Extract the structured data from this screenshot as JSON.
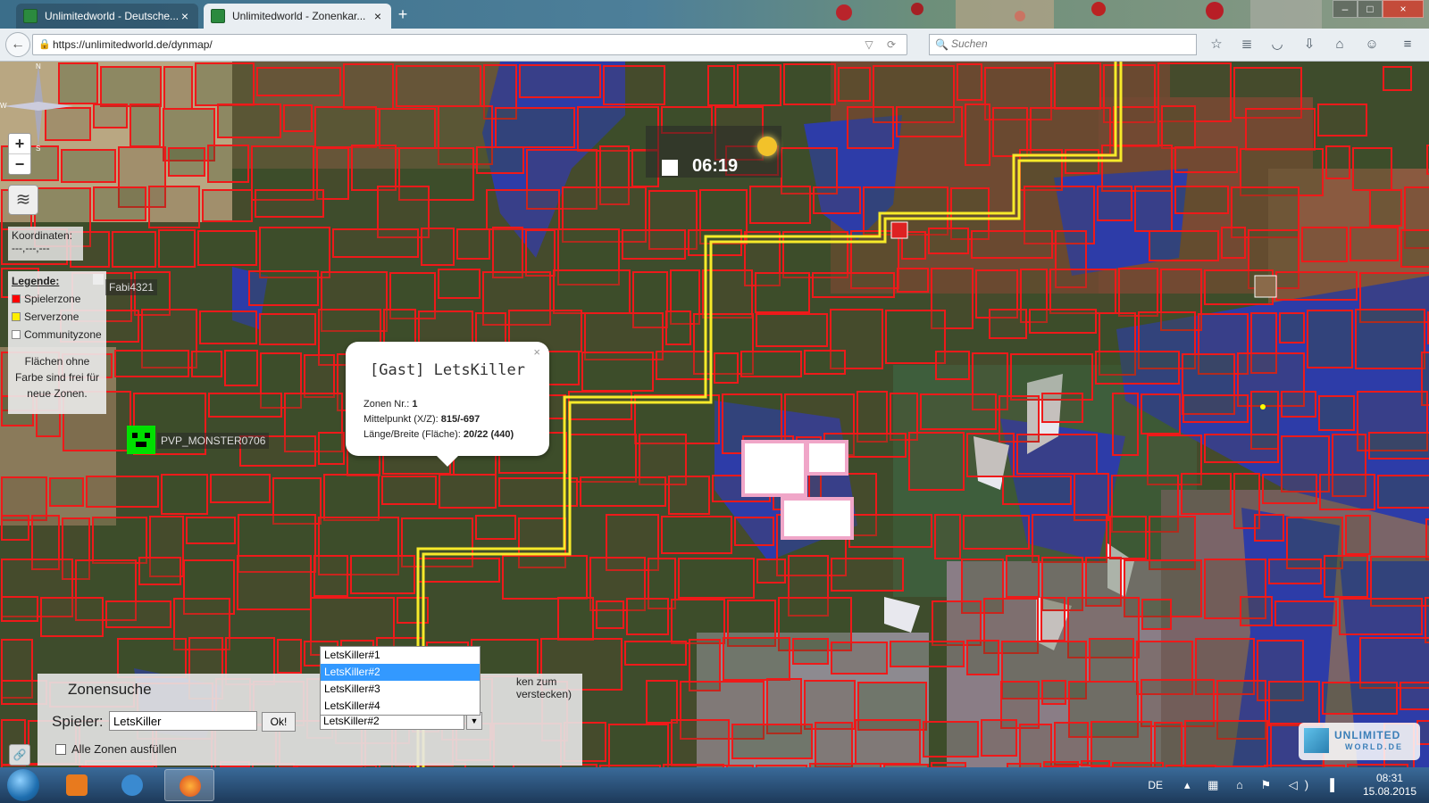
{
  "browser": {
    "tabs": [
      {
        "label": "Unlimitedworld - Deutsche...",
        "active": false
      },
      {
        "label": "Unlimitedworld - Zonenkar...",
        "active": true
      }
    ],
    "new_tab_label": "+",
    "url": "https://unlimitedworld.de/dynmap/",
    "search_placeholder": "Suchen"
  },
  "map": {
    "zoom_in": "+",
    "zoom_out": "−",
    "coordinates_label": "Koordinaten:",
    "coordinates_value": "---,---,---",
    "legend": {
      "title": "Legende:",
      "items": [
        {
          "label": "Spielerzone",
          "color": "#ff0000"
        },
        {
          "label": "Serverzone",
          "color": "#ffee00"
        },
        {
          "label": "Communityzone",
          "color": "#ffffff"
        }
      ],
      "note": "Flächen ohne Farbe sind frei für neue Zonen."
    },
    "players": [
      {
        "name": "Fabi4321"
      },
      {
        "name": "PVP_MONSTER0706"
      }
    ],
    "clock": "06:19",
    "compass": {
      "n": "N",
      "s": "S",
      "w": "W"
    },
    "popup": {
      "title": "[Gast] LetsKiller",
      "zone_label": "Zonen Nr.: ",
      "zone_value": "1",
      "center_label": "Mittelpunkt (X/Z): ",
      "center_value": "815/-697",
      "size_label": "Länge/Breite (Fläche): ",
      "size_value": "20/22 (440)",
      "close": "×"
    }
  },
  "zone_search": {
    "title": "Zonensuche",
    "hint": "ken zum verstecken)",
    "player_label": "Spieler:",
    "player_value": "LetsKiller",
    "ok_label": "Ok!",
    "selected": "LetsKiller#2",
    "options": [
      "LetsKiller#1",
      "LetsKiller#2",
      "LetsKiller#3",
      "LetsKiller#4"
    ],
    "fill_all_label": "Alle Zonen ausfüllen"
  },
  "brand": {
    "line1": "UNLIMITED",
    "line2": "WORLD.DE"
  },
  "taskbar": {
    "language": "DE",
    "time": "08:31",
    "date": "15.08.2015"
  }
}
